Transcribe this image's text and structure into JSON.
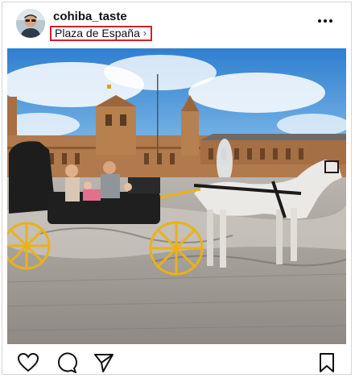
{
  "post": {
    "username": "cohiba_taste",
    "location": "Plaza de España",
    "location_chevron": "›"
  },
  "icons": {
    "more": "more-dots-icon",
    "like": "heart-icon",
    "comment": "comment-bubble-icon",
    "share": "paper-plane-icon",
    "save": "bookmark-icon"
  },
  "colors": {
    "location_highlight": "#d0202a",
    "sky": "#3f8fd6",
    "building": "#b07a4c",
    "wheel": "#e9b21a"
  }
}
